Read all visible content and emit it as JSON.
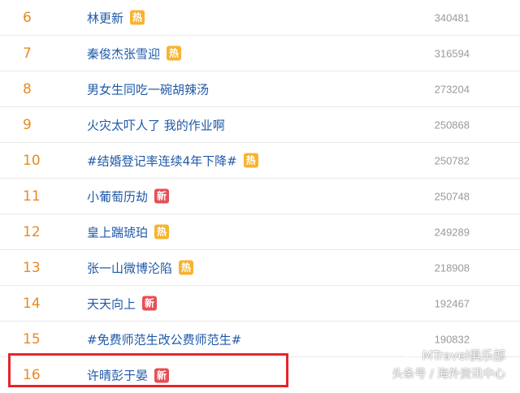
{
  "rows": [
    {
      "rank": "6",
      "title": "林更新",
      "badge": "热",
      "badge_type": "hot",
      "count": "340481"
    },
    {
      "rank": "7",
      "title": "秦俊杰张雪迎",
      "badge": "热",
      "badge_type": "hot",
      "count": "316594"
    },
    {
      "rank": "8",
      "title": "男女生同吃一碗胡辣汤",
      "badge": "",
      "badge_type": "",
      "count": "273204"
    },
    {
      "rank": "9",
      "title": "火灾太吓人了 我的作业啊",
      "badge": "",
      "badge_type": "",
      "count": "250868"
    },
    {
      "rank": "10",
      "title": "#结婚登记率连续4年下降#",
      "badge": "热",
      "badge_type": "hot",
      "count": "250782"
    },
    {
      "rank": "11",
      "title": "小葡萄历劫",
      "badge": "新",
      "badge_type": "new",
      "count": "250748"
    },
    {
      "rank": "12",
      "title": "皇上踹琥珀",
      "badge": "热",
      "badge_type": "hot",
      "count": "249289"
    },
    {
      "rank": "13",
      "title": "张一山微博沦陷",
      "badge": "热",
      "badge_type": "hot",
      "count": "218908"
    },
    {
      "rank": "14",
      "title": "天天向上",
      "badge": "新",
      "badge_type": "new",
      "count": "192467"
    },
    {
      "rank": "15",
      "title": "#免费师范生改公费师范生#",
      "badge": "",
      "badge_type": "",
      "count": "190832"
    },
    {
      "rank": "16",
      "title": "许晴彭于晏",
      "badge": "新",
      "badge_type": "new",
      "count": ""
    }
  ],
  "highlight_color": "#e3262c",
  "colors": {
    "rank": "#e98a22",
    "title_link": "#1f59a8",
    "hot_badge": "#f7b32f",
    "new_badge": "#e65055",
    "count": "#9a9a9a"
  },
  "watermark": {
    "line1": "MTravel俱乐部",
    "line2": "头条号 / 海外资讯中心",
    "icon": "wechat-icon"
  }
}
